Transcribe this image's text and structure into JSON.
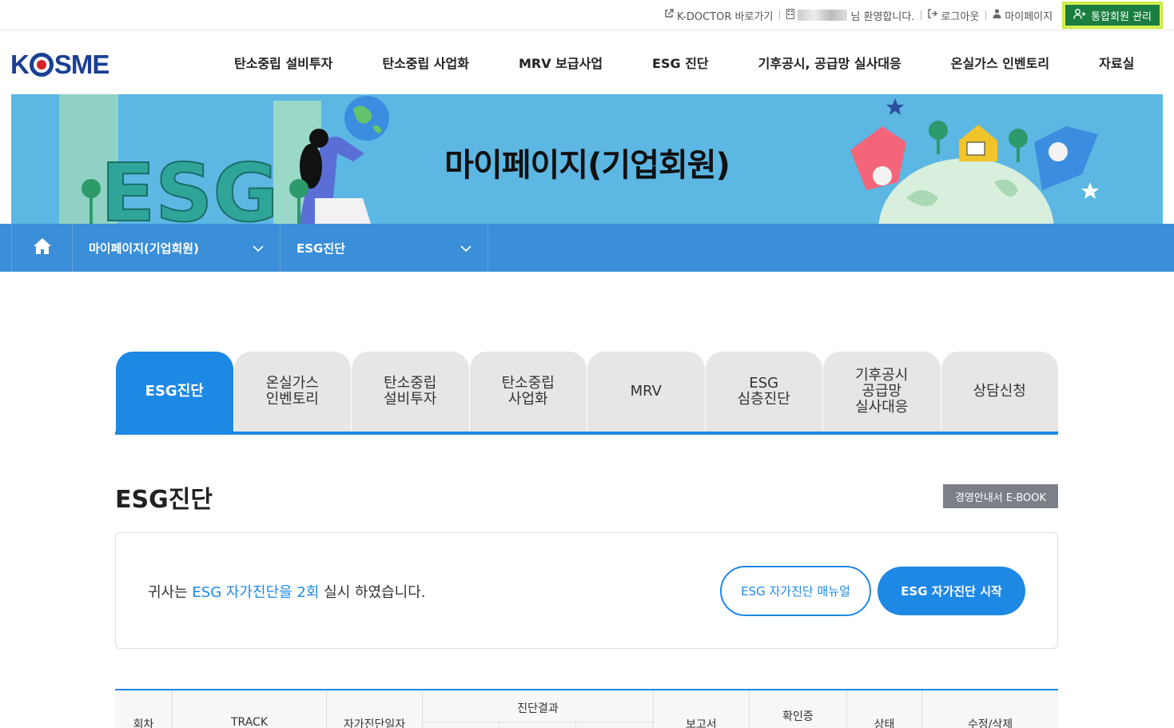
{
  "topbar": {
    "kdoctor": "K-DOCTOR 바로가기",
    "welcome": "님 환영합니다.",
    "logout": "로그아웃",
    "mypage": "마이페이지",
    "member_manage": "통합회원 관리"
  },
  "header": {
    "logo_k": "K",
    "logo_rest": "SME",
    "nav": [
      "탄소중립 설비투자",
      "탄소중립 사업화",
      "MRV 보급사업",
      "ESG 진단",
      "기후공시, 공급망 실사대응",
      "온실가스 인벤토리",
      "자료실"
    ]
  },
  "banner": {
    "title": "마이페이지(기업회원)",
    "deco_text": "ESG"
  },
  "breadcrumb": {
    "level1": "마이페이지(기업회원)",
    "level2": "ESG진단"
  },
  "tabs": [
    {
      "label": "ESG진단",
      "active": true
    },
    {
      "label": "온실가스\n인벤토리",
      "active": false
    },
    {
      "label": "탄소중립\n설비투자",
      "active": false
    },
    {
      "label": "탄소중립\n사업화",
      "active": false
    },
    {
      "label": "MRV",
      "active": false
    },
    {
      "label": "ESG\n심층진단",
      "active": false
    },
    {
      "label": "기후공시\n공급망\n실사대응",
      "active": false
    },
    {
      "label": "상담신청",
      "active": false
    }
  ],
  "section": {
    "title": "ESG진단",
    "ebook_button": "경영안내서 E-BOOK"
  },
  "info_box": {
    "msg_prefix": "귀사는 ",
    "msg_highlight": "ESG 자가진단을 2회",
    "msg_suffix": " 실시 하였습니다.",
    "manual_button": "ESG 자가진단 매뉴얼",
    "start_button": "ESG 자가진단 시작"
  },
  "table": {
    "headers": [
      "회차",
      "TRACK",
      "자가진단일자",
      "진단결과",
      "보고서",
      "확인증",
      "상태",
      "수정/삭제"
    ]
  },
  "colors": {
    "primary": "#1e88e5",
    "breadcrumb": "#3a8fd8",
    "banner": "#5cb7e3",
    "member_button": "#1b7d3f"
  }
}
